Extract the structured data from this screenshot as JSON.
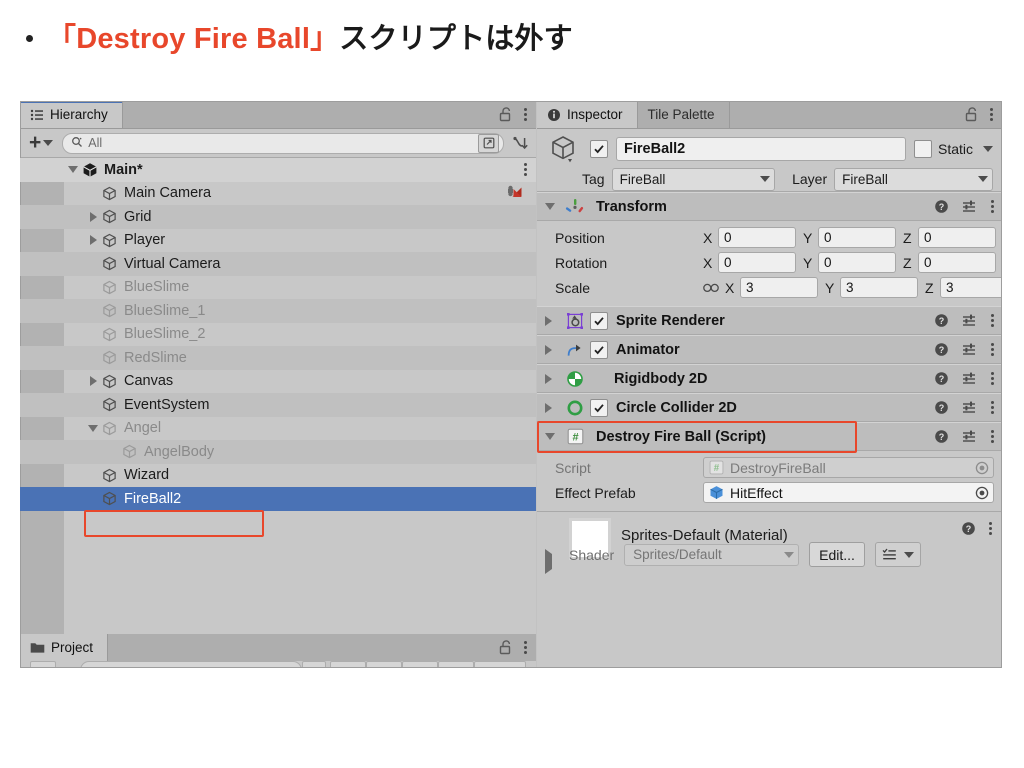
{
  "slide": {
    "bullet": "•",
    "heading_accent": "「Destroy Fire Ball」",
    "heading_rest": "スクリプトは外す"
  },
  "hierarchy": {
    "tab_label": "Hierarchy",
    "tab_icon": "hierarchy-list-icon",
    "lock_icon": "lock-open-icon",
    "menu_icon": "kebab-menu-icon",
    "toolbar": {
      "create_label": "+",
      "search_placeholder": "All",
      "search_value": "",
      "search_icon": "search-icon",
      "visibility_icon": "open-window-icon",
      "sort_icon": "sort-icon"
    },
    "items": [
      {
        "label": "Main*",
        "depth": 0,
        "twisty": "down",
        "state": "root"
      },
      {
        "label": "Main Camera",
        "depth": 1,
        "twisty": "none",
        "state": "normal",
        "right_icon": "cinemachine-icon"
      },
      {
        "label": "Grid",
        "depth": 1,
        "twisty": "right",
        "state": "normal"
      },
      {
        "label": "Player",
        "depth": 1,
        "twisty": "right",
        "state": "normal"
      },
      {
        "label": "Virtual Camera",
        "depth": 1,
        "twisty": "none",
        "state": "normal"
      },
      {
        "label": "BlueSlime",
        "depth": 1,
        "twisty": "none",
        "state": "dim"
      },
      {
        "label": "BlueSlime_1",
        "depth": 1,
        "twisty": "none",
        "state": "dim"
      },
      {
        "label": "BlueSlime_2",
        "depth": 1,
        "twisty": "none",
        "state": "dim"
      },
      {
        "label": "RedSlime",
        "depth": 1,
        "twisty": "none",
        "state": "dim"
      },
      {
        "label": "Canvas",
        "depth": 1,
        "twisty": "right",
        "state": "normal"
      },
      {
        "label": "EventSystem",
        "depth": 1,
        "twisty": "none",
        "state": "normal"
      },
      {
        "label": "Angel",
        "depth": 1,
        "twisty": "down",
        "state": "dim"
      },
      {
        "label": "AngelBody",
        "depth": 2,
        "twisty": "none",
        "state": "dim"
      },
      {
        "label": "Wizard",
        "depth": 1,
        "twisty": "none",
        "state": "normal"
      },
      {
        "label": "FireBall2",
        "depth": 1,
        "twisty": "none",
        "state": "selected"
      }
    ]
  },
  "project": {
    "tab_label": "Project",
    "tab_icon": "folder-icon",
    "lock_icon": "lock-open-icon",
    "menu_icon": "kebab-menu-icon"
  },
  "inspector": {
    "tabs": [
      {
        "label": "Inspector",
        "icon": "info-icon",
        "active": true
      },
      {
        "label": "Tile Palette",
        "icon": "none",
        "active": false
      }
    ],
    "lock_icon": "lock-open-icon",
    "menu_icon": "kebab-menu-icon",
    "gameobject": {
      "icon": "gameobject-cube-icon",
      "enabled": true,
      "name": "FireBall2",
      "static_label": "Static",
      "static_checked": false,
      "tag_label": "Tag",
      "tag_value": "FireBall",
      "layer_label": "Layer",
      "layer_value": "FireBall"
    },
    "transform": {
      "title": "Transform",
      "icon": "transform-axes-icon",
      "expanded": true,
      "help_icon": "help-icon",
      "preset_icon": "preset-sliders-icon",
      "menu_icon": "kebab-menu-icon",
      "rows": [
        {
          "name": "Position",
          "linked": false,
          "x": "0",
          "y": "0",
          "z": "0"
        },
        {
          "name": "Rotation",
          "linked": false,
          "x": "0",
          "y": "0",
          "z": "0"
        },
        {
          "name": "Scale",
          "linked": true,
          "x": "3",
          "y": "3",
          "z": "3"
        }
      ],
      "axis_labels": [
        "X",
        "Y",
        "Z"
      ]
    },
    "components": [
      {
        "title": "Sprite Renderer",
        "icon": "sprite-renderer-icon",
        "has_checkbox": true,
        "checked": true,
        "expanded": false,
        "highlighted": false
      },
      {
        "title": "Animator",
        "icon": "animator-icon",
        "has_checkbox": true,
        "checked": true,
        "expanded": false,
        "highlighted": false
      },
      {
        "title": "Rigidbody 2D",
        "icon": "rigidbody2d-icon",
        "has_checkbox": false,
        "checked": false,
        "expanded": false,
        "highlighted": false
      },
      {
        "title": "Circle Collider 2D",
        "icon": "circlecollider2d-icon",
        "has_checkbox": true,
        "checked": true,
        "expanded": false,
        "highlighted": false
      }
    ],
    "script_component": {
      "title": "Destroy Fire Ball (Script)",
      "icon": "cs-script-icon",
      "expanded": true,
      "highlighted": true,
      "highlight_color": "#e8472b",
      "fields": [
        {
          "label": "Script",
          "value": "DestroyFireBall",
          "icon": "cs-script-icon",
          "disabled": true,
          "picker_icon": "object-picker-icon"
        },
        {
          "label": "Effect Prefab",
          "value": "HitEffect",
          "icon": "prefab-cube-icon",
          "disabled": false,
          "picker_icon": "object-picker-icon"
        }
      ]
    },
    "material": {
      "title": "Sprites-Default (Material)",
      "swatch_color": "#ffffff",
      "shader_label": "Shader",
      "shader_value": "Sprites/Default",
      "edit_label": "Edit...",
      "help_icon": "help-icon",
      "menu_icon": "kebab-menu-icon",
      "list_icon": "list-options-icon"
    }
  },
  "colors": {
    "accent_red": "#e8472b",
    "selection_blue": "#4a72b5",
    "panel_bg": "#c8c8c8",
    "tab_bg": "#aeaeae",
    "component_header": "#bdbdbd"
  }
}
